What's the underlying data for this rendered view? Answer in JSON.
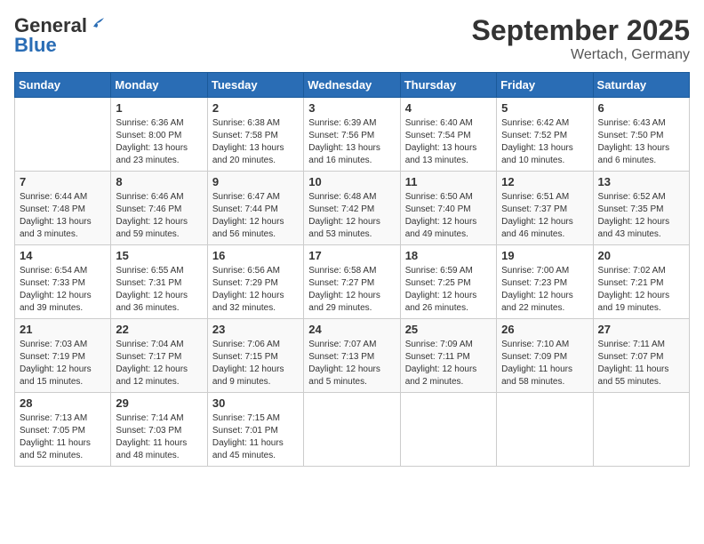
{
  "header": {
    "logo_general": "General",
    "logo_blue": "Blue",
    "month": "September 2025",
    "location": "Wertach, Germany"
  },
  "weekdays": [
    "Sunday",
    "Monday",
    "Tuesday",
    "Wednesday",
    "Thursday",
    "Friday",
    "Saturday"
  ],
  "weeks": [
    [
      {
        "day": "",
        "info": ""
      },
      {
        "day": "1",
        "info": "Sunrise: 6:36 AM\nSunset: 8:00 PM\nDaylight: 13 hours\nand 23 minutes."
      },
      {
        "day": "2",
        "info": "Sunrise: 6:38 AM\nSunset: 7:58 PM\nDaylight: 13 hours\nand 20 minutes."
      },
      {
        "day": "3",
        "info": "Sunrise: 6:39 AM\nSunset: 7:56 PM\nDaylight: 13 hours\nand 16 minutes."
      },
      {
        "day": "4",
        "info": "Sunrise: 6:40 AM\nSunset: 7:54 PM\nDaylight: 13 hours\nand 13 minutes."
      },
      {
        "day": "5",
        "info": "Sunrise: 6:42 AM\nSunset: 7:52 PM\nDaylight: 13 hours\nand 10 minutes."
      },
      {
        "day": "6",
        "info": "Sunrise: 6:43 AM\nSunset: 7:50 PM\nDaylight: 13 hours\nand 6 minutes."
      }
    ],
    [
      {
        "day": "7",
        "info": "Sunrise: 6:44 AM\nSunset: 7:48 PM\nDaylight: 13 hours\nand 3 minutes."
      },
      {
        "day": "8",
        "info": "Sunrise: 6:46 AM\nSunset: 7:46 PM\nDaylight: 12 hours\nand 59 minutes."
      },
      {
        "day": "9",
        "info": "Sunrise: 6:47 AM\nSunset: 7:44 PM\nDaylight: 12 hours\nand 56 minutes."
      },
      {
        "day": "10",
        "info": "Sunrise: 6:48 AM\nSunset: 7:42 PM\nDaylight: 12 hours\nand 53 minutes."
      },
      {
        "day": "11",
        "info": "Sunrise: 6:50 AM\nSunset: 7:40 PM\nDaylight: 12 hours\nand 49 minutes."
      },
      {
        "day": "12",
        "info": "Sunrise: 6:51 AM\nSunset: 7:37 PM\nDaylight: 12 hours\nand 46 minutes."
      },
      {
        "day": "13",
        "info": "Sunrise: 6:52 AM\nSunset: 7:35 PM\nDaylight: 12 hours\nand 43 minutes."
      }
    ],
    [
      {
        "day": "14",
        "info": "Sunrise: 6:54 AM\nSunset: 7:33 PM\nDaylight: 12 hours\nand 39 minutes."
      },
      {
        "day": "15",
        "info": "Sunrise: 6:55 AM\nSunset: 7:31 PM\nDaylight: 12 hours\nand 36 minutes."
      },
      {
        "day": "16",
        "info": "Sunrise: 6:56 AM\nSunset: 7:29 PM\nDaylight: 12 hours\nand 32 minutes."
      },
      {
        "day": "17",
        "info": "Sunrise: 6:58 AM\nSunset: 7:27 PM\nDaylight: 12 hours\nand 29 minutes."
      },
      {
        "day": "18",
        "info": "Sunrise: 6:59 AM\nSunset: 7:25 PM\nDaylight: 12 hours\nand 26 minutes."
      },
      {
        "day": "19",
        "info": "Sunrise: 7:00 AM\nSunset: 7:23 PM\nDaylight: 12 hours\nand 22 minutes."
      },
      {
        "day": "20",
        "info": "Sunrise: 7:02 AM\nSunset: 7:21 PM\nDaylight: 12 hours\nand 19 minutes."
      }
    ],
    [
      {
        "day": "21",
        "info": "Sunrise: 7:03 AM\nSunset: 7:19 PM\nDaylight: 12 hours\nand 15 minutes."
      },
      {
        "day": "22",
        "info": "Sunrise: 7:04 AM\nSunset: 7:17 PM\nDaylight: 12 hours\nand 12 minutes."
      },
      {
        "day": "23",
        "info": "Sunrise: 7:06 AM\nSunset: 7:15 PM\nDaylight: 12 hours\nand 9 minutes."
      },
      {
        "day": "24",
        "info": "Sunrise: 7:07 AM\nSunset: 7:13 PM\nDaylight: 12 hours\nand 5 minutes."
      },
      {
        "day": "25",
        "info": "Sunrise: 7:09 AM\nSunset: 7:11 PM\nDaylight: 12 hours\nand 2 minutes."
      },
      {
        "day": "26",
        "info": "Sunrise: 7:10 AM\nSunset: 7:09 PM\nDaylight: 11 hours\nand 58 minutes."
      },
      {
        "day": "27",
        "info": "Sunrise: 7:11 AM\nSunset: 7:07 PM\nDaylight: 11 hours\nand 55 minutes."
      }
    ],
    [
      {
        "day": "28",
        "info": "Sunrise: 7:13 AM\nSunset: 7:05 PM\nDaylight: 11 hours\nand 52 minutes."
      },
      {
        "day": "29",
        "info": "Sunrise: 7:14 AM\nSunset: 7:03 PM\nDaylight: 11 hours\nand 48 minutes."
      },
      {
        "day": "30",
        "info": "Sunrise: 7:15 AM\nSunset: 7:01 PM\nDaylight: 11 hours\nand 45 minutes."
      },
      {
        "day": "",
        "info": ""
      },
      {
        "day": "",
        "info": ""
      },
      {
        "day": "",
        "info": ""
      },
      {
        "day": "",
        "info": ""
      }
    ]
  ]
}
